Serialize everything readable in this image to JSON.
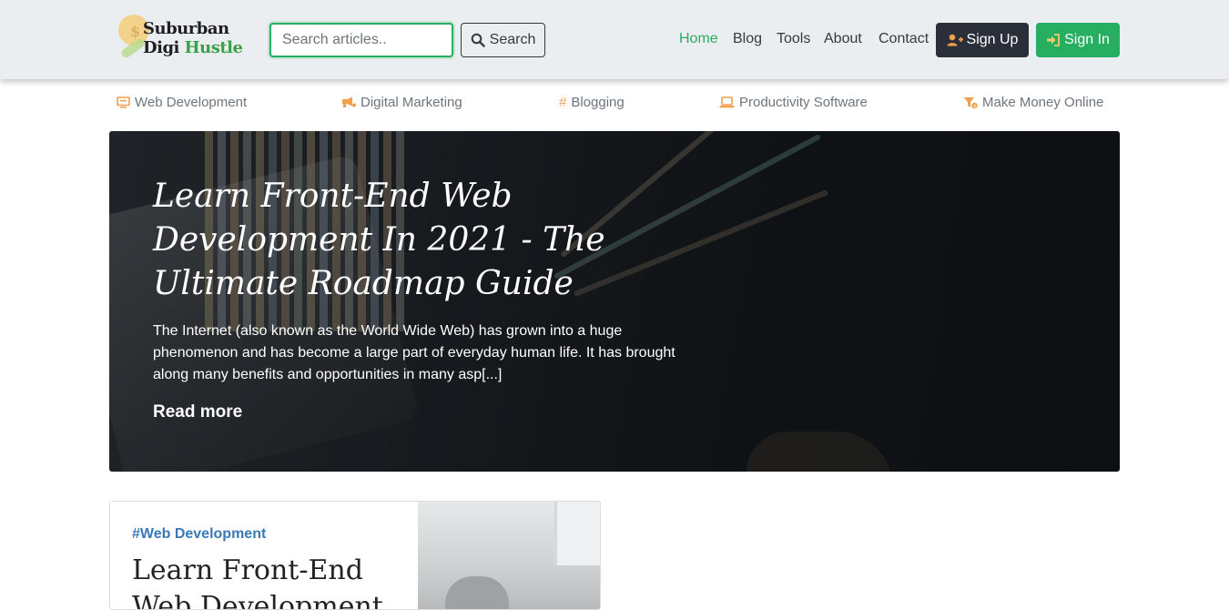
{
  "brand": {
    "line1": "Suburban",
    "line2a": "Digi ",
    "line2b": "Hustle",
    "coin_symbol": "$"
  },
  "search": {
    "placeholder": "Search articles..",
    "value": "",
    "button_label": "Search"
  },
  "nav": {
    "links": [
      "Home",
      "Blog",
      "Tools",
      "About",
      "Contact"
    ],
    "active": "Home"
  },
  "auth": {
    "signup_label": "Sign Up",
    "signin_label": "Sign In"
  },
  "categories": [
    {
      "label": "Web Development",
      "icon": "monitor-code-icon"
    },
    {
      "label": "Digital Marketing",
      "icon": "megaphone-icon"
    },
    {
      "label": "Blogging",
      "icon": "hashtag-icon"
    },
    {
      "label": "Productivity Software",
      "icon": "laptop-icon"
    },
    {
      "label": "Make Money Online",
      "icon": "money-funnel-icon"
    }
  ],
  "hero": {
    "title": "Learn Front-End Web Development In 2021 - The Ultimate Roadmap Guide",
    "excerpt": "The Internet (also known as the World Wide Web) has grown into a huge phenomenon and has become a large part of everyday human life. It has brought along many benefits and opportunities in many asp[...]",
    "read_more": "Read more"
  },
  "card": {
    "tag": "#Web Development",
    "title": "Learn Front-End Web Development"
  },
  "colors": {
    "accent": "#27ae60",
    "dark": "#2a2f3a",
    "category_icon": "#f0a04b",
    "tag": "#3a79b8"
  }
}
